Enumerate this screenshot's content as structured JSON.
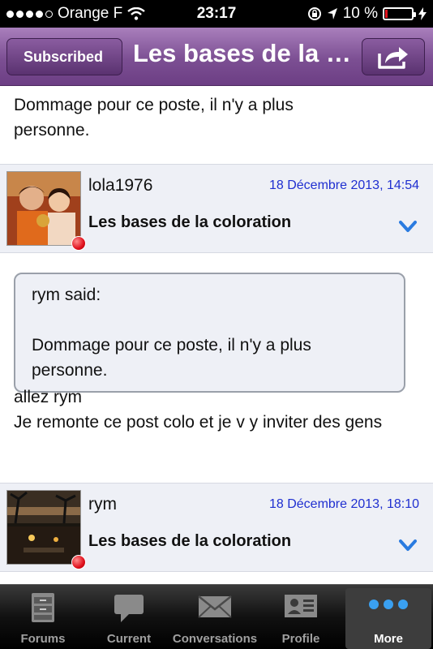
{
  "status_bar": {
    "carrier": "Orange F",
    "time": "23:17",
    "battery": "10 %",
    "battery_level": 0.1
  },
  "nav": {
    "back_label": "Subscribed",
    "title": "Les bases de la coloration",
    "share_icon": "share-icon"
  },
  "posts": {
    "prev_text": "Dommage pour ce poste, il n'y a plus personne.",
    "items": [
      {
        "username": "lola1976",
        "date": "18 Décembre 2013, 14:54",
        "title": "Les bases de la coloration",
        "quote_author": "rym said:",
        "quote_text": "Dommage pour ce poste, il n'y a plus personne.",
        "body_line1": "allez rym",
        "body_line2": "Je remonte ce post colo et je v y inviter des gens"
      },
      {
        "username": "rym",
        "date": "18 Décembre 2013, 18:10",
        "title": "Les bases de la coloration"
      }
    ]
  },
  "tabs": [
    {
      "label": "Forums",
      "icon": "cabinet-icon"
    },
    {
      "label": "Current",
      "icon": "speech-bubble-icon"
    },
    {
      "label": "Conversations",
      "icon": "envelope-icon"
    },
    {
      "label": "Profile",
      "icon": "id-card-icon"
    },
    {
      "label": "More",
      "icon": "more-dots-icon",
      "active": true
    }
  ],
  "colors": {
    "nav_purple": "#7c4f93",
    "date_blue": "#1f2fd0",
    "online_red": "#e0101c",
    "chevron_blue": "#2a7be0"
  }
}
